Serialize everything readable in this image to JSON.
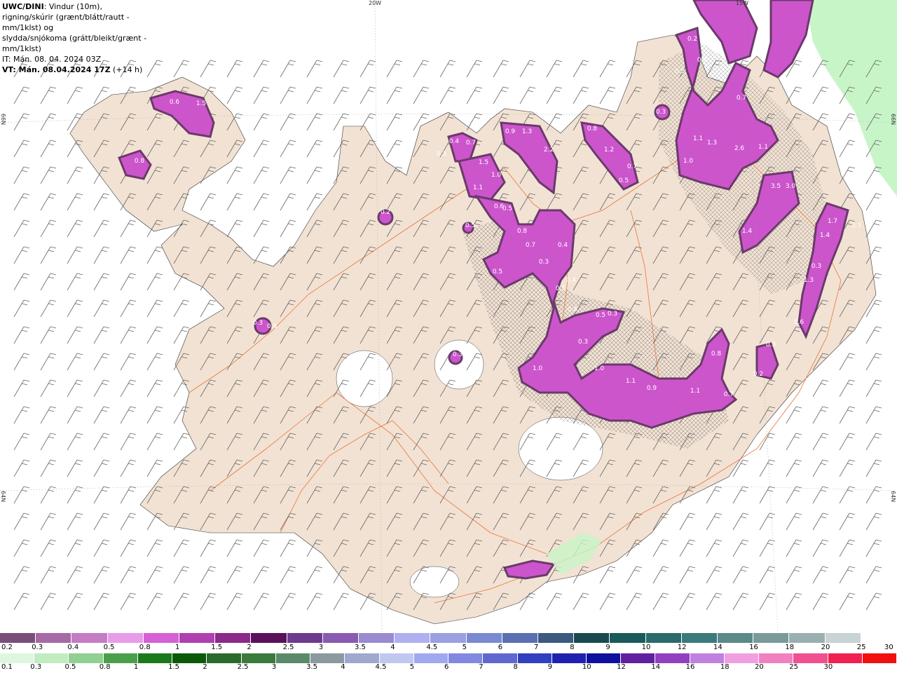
{
  "info": {
    "title": "UWC/DINI",
    "line1": ": Vindur (10m),",
    "line2": "rigning/skúrir (grænt/blátt/rautt - mm/1klst) og",
    "line3": "slydda/snjókoma (grátt/bleikt/grænt - mm/1klst)",
    "it": "IT: Mán. 08. 04. 2024 03Z",
    "vt_bold": "VT: Mán. 08.04.2024 17Z",
    "vt_rest": " (+14 h)"
  },
  "grid_labels": {
    "top_20w": "20W",
    "top_15w": "15W",
    "left_66n": "66N",
    "left_64n": "64N",
    "right_66n": "66N",
    "right_64n": "64N"
  },
  "colors": {
    "sea": "#ffffff",
    "land": "#f2e2d3",
    "roads": "#e8743b",
    "snow_light": "#f5a0f5",
    "snow_mid": "#cc55cc",
    "snow_dark": "#6a3a6a",
    "rain_light": "#c8f5c8"
  },
  "precip_values": [
    "0.6",
    "1.5",
    "0.8",
    "0.3",
    "0.4",
    "0.7",
    "1.5",
    "1.1",
    "1.0",
    "0.9",
    "1.3",
    "2.2",
    "0.8",
    "1.2",
    "0.7",
    "0.5",
    "0.3",
    "0.2",
    "0.7",
    "0.3",
    "1.1",
    "1.3",
    "2.6",
    "1.1",
    "1.0",
    "0.7",
    "3.5",
    "3.0",
    "1.4",
    "1.7",
    "1.4",
    "0.7",
    "0.3",
    "1.3",
    "0.6",
    "0.5",
    "0.8",
    "0.7",
    "0.4",
    "0.3",
    "0.4",
    "0.5",
    "0.5",
    "0.3",
    "0.3",
    "0.4",
    "0.3",
    "0.2",
    "1.0",
    "1.0",
    "1.1",
    "0.9",
    "1.1",
    "0.7",
    "0.8",
    "0.4",
    "0.3",
    "0.2",
    "0.5",
    "0.6",
    "0.5",
    "0.3"
  ],
  "legend_snow": {
    "colors": [
      "#7a4f7a",
      "#a66aa6",
      "#c47cc4",
      "#e89be8",
      "#d462d4",
      "#b040b0",
      "#8a2a8a",
      "#5a105a",
      "#6e3a8e",
      "#8a5ab0",
      "#9a8ad0",
      "#b0b0f0",
      "#9aa0e0",
      "#7a8ad0",
      "#5a70b0",
      "#3a5a80",
      "#1a4a50",
      "#1a5a5a",
      "#2a6a6a",
      "#3a7a7a",
      "#5a8a8a",
      "#7a9a9a",
      "#9ab0b0",
      "#c8d4d4",
      "#ffffff"
    ],
    "labels": [
      "0.2",
      "0.3",
      "0.4",
      "0.5",
      "0.8",
      "1",
      "1.5",
      "2",
      "2.5",
      "3",
      "3.5",
      "4",
      "4.5",
      "5",
      "6",
      "7",
      "8",
      "9",
      "10",
      "12",
      "14",
      "16",
      "18",
      "20",
      "25",
      "30"
    ]
  },
  "legend_rain": {
    "colors": [
      "#dff5df",
      "#c0ecc0",
      "#90d090",
      "#4aa04a",
      "#1a7a1a",
      "#0a5a0a",
      "#2a6a2a",
      "#3a7a3a",
      "#5a8a6a",
      "#8a9aa0",
      "#a0a8d0",
      "#c0c8f0",
      "#a0a8f0",
      "#8088e0",
      "#6068d0",
      "#3040c0",
      "#2020b0",
      "#1010a0",
      "#6020a0",
      "#9040c0",
      "#c080e0",
      "#f0a0e0",
      "#f080c0",
      "#f05090",
      "#f02050",
      "#f01010"
    ],
    "labels": [
      "0.1",
      "0.3",
      "0.5",
      "0.8",
      "1",
      "1.5",
      "2",
      "2.5",
      "3",
      "3.5",
      "4",
      "4.5",
      "5",
      "6",
      "7",
      "8",
      "9",
      "10",
      "12",
      "14",
      "16",
      "18",
      "20",
      "25",
      "30"
    ]
  }
}
